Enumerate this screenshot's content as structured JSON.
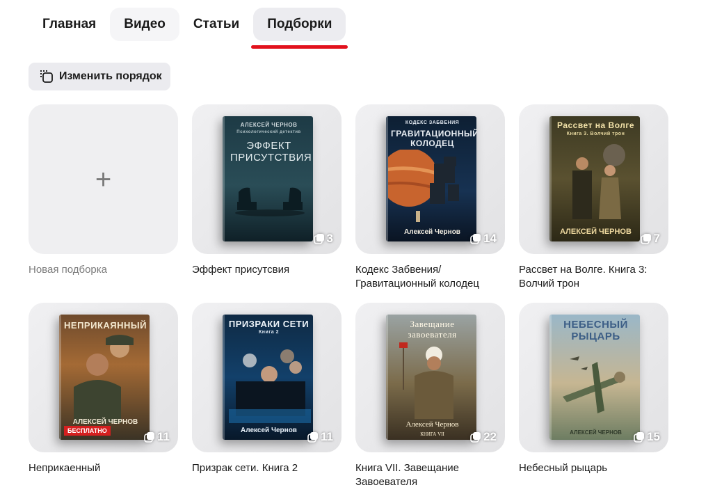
{
  "tabs": [
    {
      "label": "Главная"
    },
    {
      "label": "Видео"
    },
    {
      "label": "Статьи"
    },
    {
      "label": "Подборки"
    }
  ],
  "reorder_label": "Изменить порядок",
  "new_collection_label": "Новая подборка",
  "collections": [
    {
      "caption": "Эффект присутсвия",
      "count": "3",
      "cover_title": "ЭФФЕКТ ПРИСУТСТВИЯ",
      "cover_author": "АЛЕКСЕЙ ЧЕРНОВ",
      "cover_subtitle": "Психологический детектив"
    },
    {
      "caption": "Кодекс Забвения/ Гравитационный колодец",
      "count": "14",
      "cover_title": "ГРАВИТАЦИОННЫЙ КОЛОДЕЦ",
      "cover_author": "Алексей Чернов",
      "cover_subtitle": "КОДЕКС ЗАБВЕНИЯ"
    },
    {
      "caption": "Рассвет на Волге. Книга 3: Волчий трон",
      "count": "7",
      "cover_title": "Рассвет на Волге",
      "cover_author": "АЛЕКСЕЙ ЧЕРНОВ",
      "cover_subtitle": "Книга 3. Волчий трон"
    },
    {
      "caption": "Неприкаенный",
      "count": "11",
      "cover_title": "НЕПРИКАЯННЫЙ",
      "cover_author": "АЛЕКСЕЙ ЧЕРНОВ",
      "cover_subtitle": "",
      "badge": "БЕСПЛАТНО"
    },
    {
      "caption": "Призрак сети. Книга 2",
      "count": "11",
      "cover_title": "ПРИЗРАКИ СЕТИ",
      "cover_author": "Алексей Чернов",
      "cover_subtitle": "Книга 2"
    },
    {
      "caption": "Книга VII. Завещание Завоевателя",
      "count": "22",
      "cover_title": "Завещание завоевателя",
      "cover_author": "Алексей Чернов",
      "cover_subtitle": "Книга VII"
    },
    {
      "caption": "Небесный рыцарь",
      "count": "15",
      "cover_title": "НЕБЕСНЫЙ РЫЦАРЬ",
      "cover_author": "АЛЕКСЕЙ ЧЕРНОВ",
      "cover_subtitle": ""
    }
  ],
  "colors": {
    "accent": "#e2111c",
    "tile_bg": "#efeff1",
    "active_tab_bg": "#ececf0"
  }
}
